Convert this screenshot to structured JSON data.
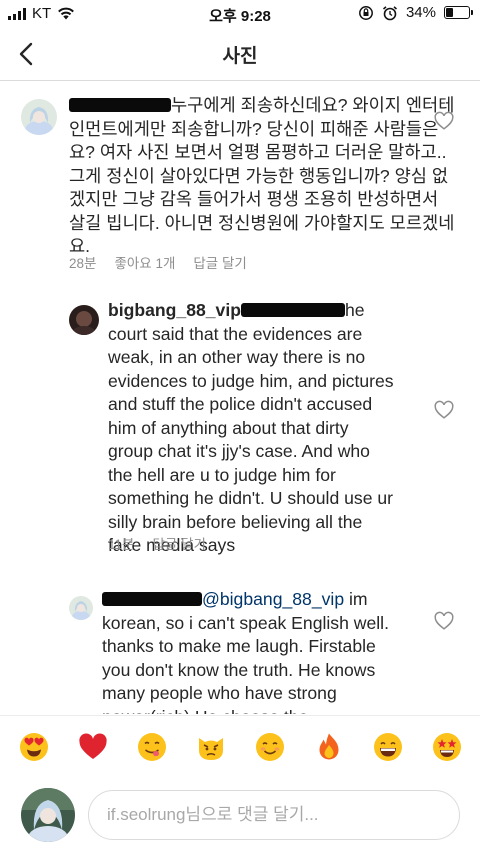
{
  "status_bar": {
    "carrier": "KT",
    "time": "오후 9:28",
    "battery": "34%",
    "battery_level": 0.34
  },
  "header": {
    "title": "사진"
  },
  "comments": [
    {
      "text": "누구에게 죄송하신데요? 와이지 엔터테인먼트에게만 죄송합니까? 당신이 피해준 사람들은요? 여자 사진 보면서 얼평 몸평하고 더러운 말하고.. 그게 정신이 살아있다면 가능한 행동입니까? 양심 없겠지만 그냥 감옥 들어가서 평생 조용히 반성하면서 살길 빕니다. 아니면 정신병원에 가야할지도 모르겠네요.",
      "time": "28분",
      "likes": "좋아요 1개",
      "reply": "답글 달기"
    },
    {
      "username": "bigbang_88_vip",
      "text": "he court said that the evidences are weak, in an other way there is no evidences to judge him, and pictures and stuff the police didn't accused him of anything about that dirty group chat it's jjy's case. And who the hell are u to judge him for something he didn't. U should use ur silly brain before believing all the fake media says",
      "time": "11분",
      "reply": "답글 달기"
    },
    {
      "mention": "@bigbang_88_vip",
      "text": " im korean, so i can't speak English well. thanks to make me laugh. Firstable you don't know the truth. He knows many people who have strong power(rich) He choose the"
    }
  ],
  "emojis": [
    "heart-eyes",
    "red-heart",
    "face-savoring",
    "pouting-cat",
    "smiling-face",
    "fire",
    "grinning-face",
    "star-struck"
  ],
  "input": {
    "placeholder": "if.seolrung님으로 댓글 달기..."
  }
}
